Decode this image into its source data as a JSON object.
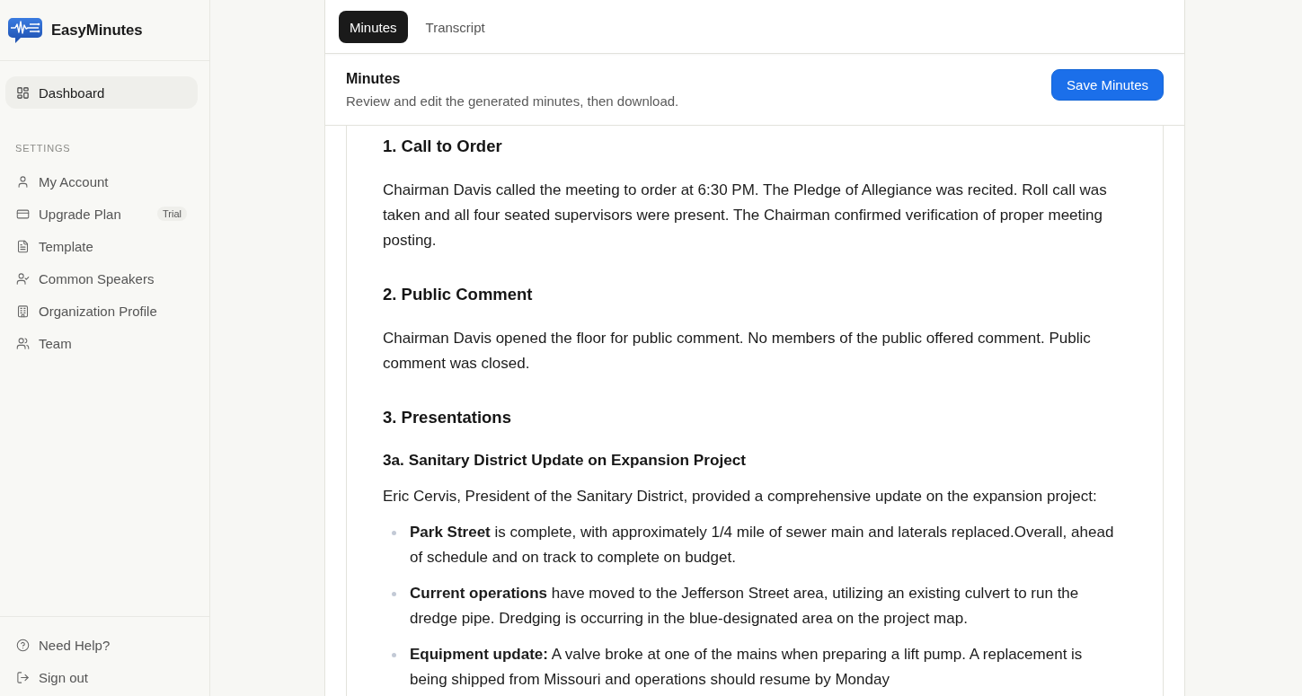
{
  "app": {
    "name": "EasyMinutes"
  },
  "sidebar": {
    "main_items": [
      {
        "label": "Dashboard",
        "selected": true
      }
    ],
    "section_label": "SETTINGS",
    "settings_items": [
      {
        "label": "My Account",
        "selected": false
      },
      {
        "label": "Upgrade Plan",
        "selected": false,
        "badge": "Trial"
      },
      {
        "label": "Template",
        "selected": false
      },
      {
        "label": "Common Speakers",
        "selected": false
      },
      {
        "label": "Organization Profile",
        "selected": false
      },
      {
        "label": "Team",
        "selected": false
      }
    ],
    "footer_items": [
      {
        "label": "Need Help?"
      },
      {
        "label": "Sign out"
      }
    ]
  },
  "tabs": [
    {
      "label": "Minutes",
      "selected": true
    },
    {
      "label": "Transcript",
      "selected": false
    }
  ],
  "header": {
    "title": "Minutes",
    "subtitle": "Review and edit the generated minutes, then download.",
    "button": "Save Minutes"
  },
  "document": {
    "blocks": [
      {
        "kind": "heading",
        "text": "1. Call to Order"
      },
      {
        "kind": "paragraph",
        "text": "Chairman Davis called the meeting to order at 6:30 PM. The Pledge of Allegiance was recited. Roll call was taken and all four seated supervisors were present. The Chairman confirmed verification of proper meeting posting."
      },
      {
        "kind": "heading",
        "text": "2. Public Comment"
      },
      {
        "kind": "paragraph",
        "text": "Chairman Davis opened the floor for public comment. No members of the public offered comment. Public comment was closed."
      },
      {
        "kind": "heading",
        "text": "3. Presentations"
      },
      {
        "kind": "subheading",
        "text": "3a. Sanitary District Update on Expansion Project"
      },
      {
        "kind": "paragraph",
        "text": "Eric Cervis, President of the Sanitary District, provided a comprehensive update on the expansion project:"
      },
      {
        "kind": "bullets",
        "items": [
          "**Park Street** is complete, with approximately 1/4 mile of sewer main and laterals replaced.Overall, ahead of schedule and on track to complete on budget.",
          "**Current operations** have moved to the Jefferson Street area, utilizing an existing culvert to run the dredge pipe. Dredging is occurring in the blue-designated area on the project map.",
          "**Equipment update:** A valve broke at one of the mains when preparing a lift pump. A replacement is being shipped from Missouri and operations should resume by Monday"
        ]
      }
    ]
  }
}
